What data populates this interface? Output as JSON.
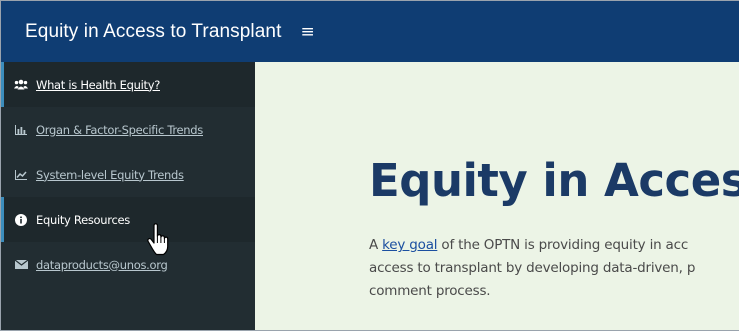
{
  "app": {
    "title": "Equity in Access to Transplant",
    "menu_icon": "hamburger-icon",
    "colors": {
      "header": "#0f3d73",
      "sidebar": "#222d32",
      "main_bg": "#ecf4e6",
      "title": "#1b3a66",
      "accent": "#3c8dbc"
    }
  },
  "sidebar": {
    "items": [
      {
        "label": "What is Health Equity?",
        "icon": "users-icon",
        "state": "hover"
      },
      {
        "label": "Organ & Factor-Specific Trends",
        "icon": "bar-chart-icon",
        "state": "default"
      },
      {
        "label": "System-level Equity Trends",
        "icon": "line-chart-icon",
        "state": "default"
      },
      {
        "label": "Equity Resources",
        "icon": "info-circle-icon",
        "state": "active"
      },
      {
        "label": "dataproducts@unos.org",
        "icon": "envelope-icon",
        "state": "default"
      }
    ]
  },
  "main": {
    "heading": "Equity in Access t",
    "intro": {
      "line1_prefix": "A ",
      "link": "key goal",
      "line1_suffix": " of the OPTN is providing equity in acc",
      "line2": "access to transplant by developing data-driven, p",
      "line3": "comment process."
    }
  },
  "pointer": {
    "icon": "hand-pointer-icon"
  }
}
